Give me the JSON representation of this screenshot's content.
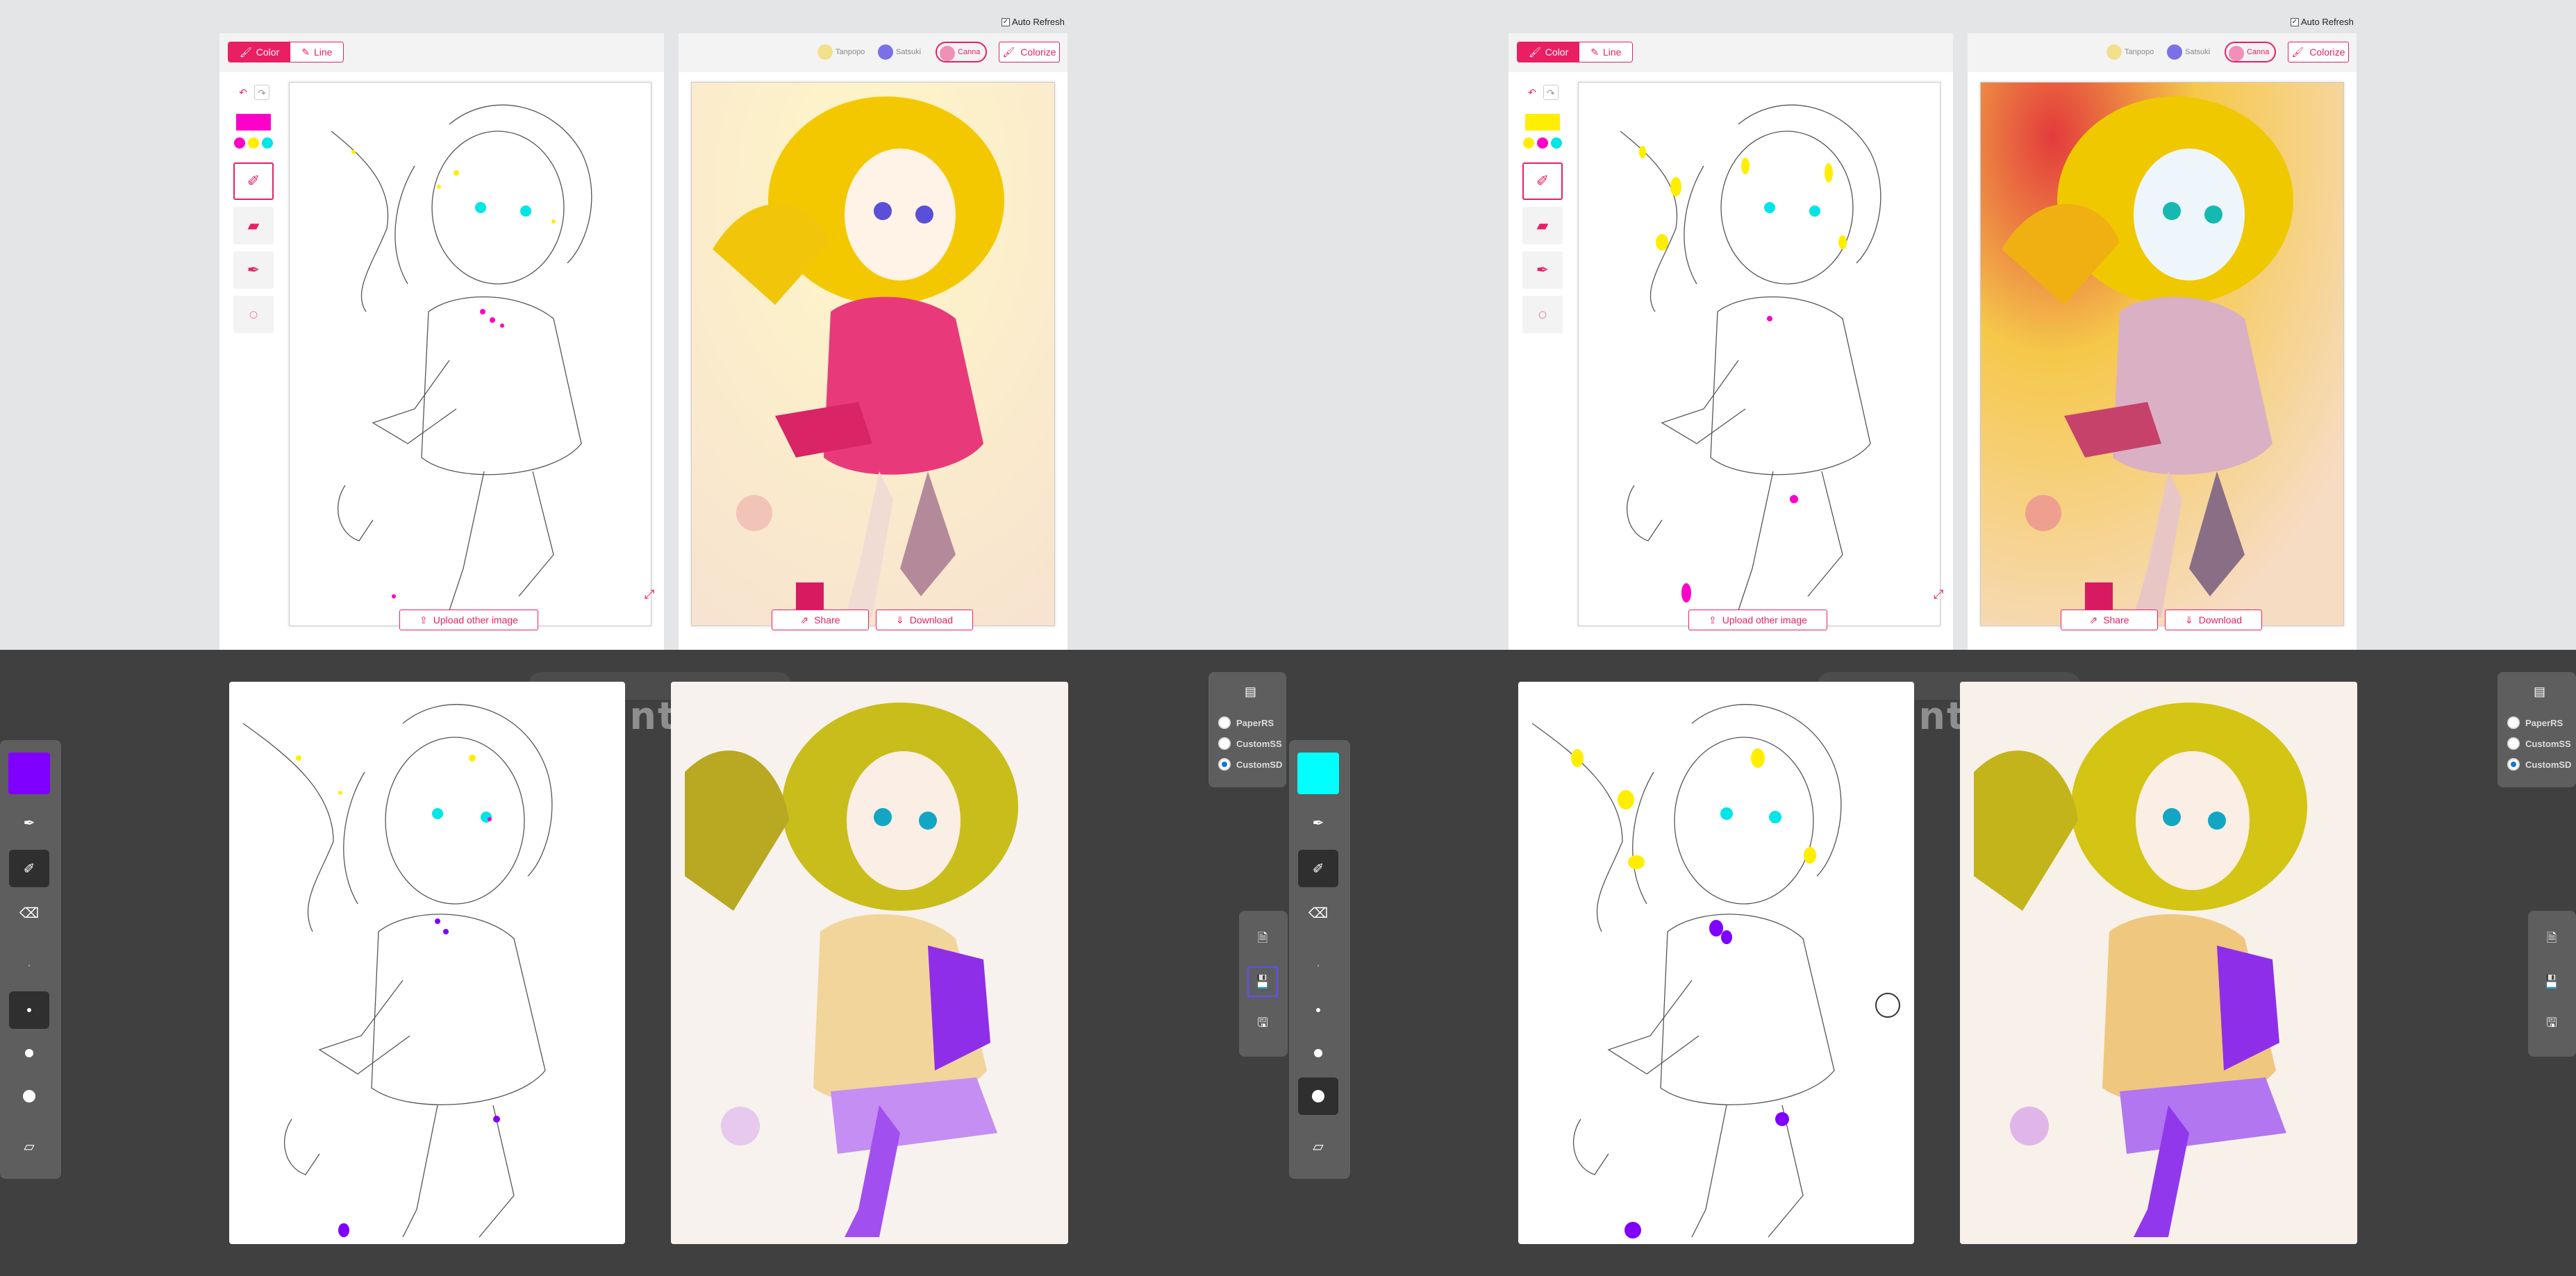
{
  "top": {
    "auto_refresh_label": "Auto Refresh",
    "mode_tabs": [
      {
        "label": "Color"
      },
      {
        "label": "Line"
      }
    ],
    "models": [
      {
        "label": "Tanpopo",
        "color": "#f3e08a"
      },
      {
        "label": "Satsuki",
        "color": "#7b70e8"
      },
      {
        "label": "Canna",
        "color": "#f08fb8"
      }
    ],
    "colorize_label": "Colorize",
    "upload_label": "Upload other image",
    "share_label": "Share",
    "download_label": "Download",
    "accent": "#e91e63",
    "panes": [
      {
        "current_color": "#ff00c8",
        "palette": [
          "#ff00c8",
          "#ffee00",
          "#00e5e5"
        ],
        "selected_model": "Canna"
      },
      {
        "current_color": "#ffee00",
        "palette": [
          "#ffee00",
          "#ff00c8",
          "#00e5e5"
        ],
        "selected_model": "Canna"
      }
    ]
  },
  "bottom": {
    "ghost_text": "ints",
    "render_modes": [
      {
        "label": "PaperRS",
        "selected": false
      },
      {
        "label": "CustomSS",
        "selected": false
      },
      {
        "label": "CustomSD",
        "selected": true
      }
    ],
    "panes": [
      {
        "current_color": "#8000ff",
        "selected_brush_size": "medium"
      },
      {
        "current_color": "#00ffff",
        "selected_brush_size": "xlarge"
      }
    ],
    "icons": {
      "eyedropper": "eyedropper-icon",
      "brush": "brush-icon",
      "eraser": "eraser-icon",
      "note": "note-icon",
      "file": "file-icon",
      "save": "save-icon",
      "save_as": "save-as-icon",
      "archive": "archive-icon"
    }
  }
}
